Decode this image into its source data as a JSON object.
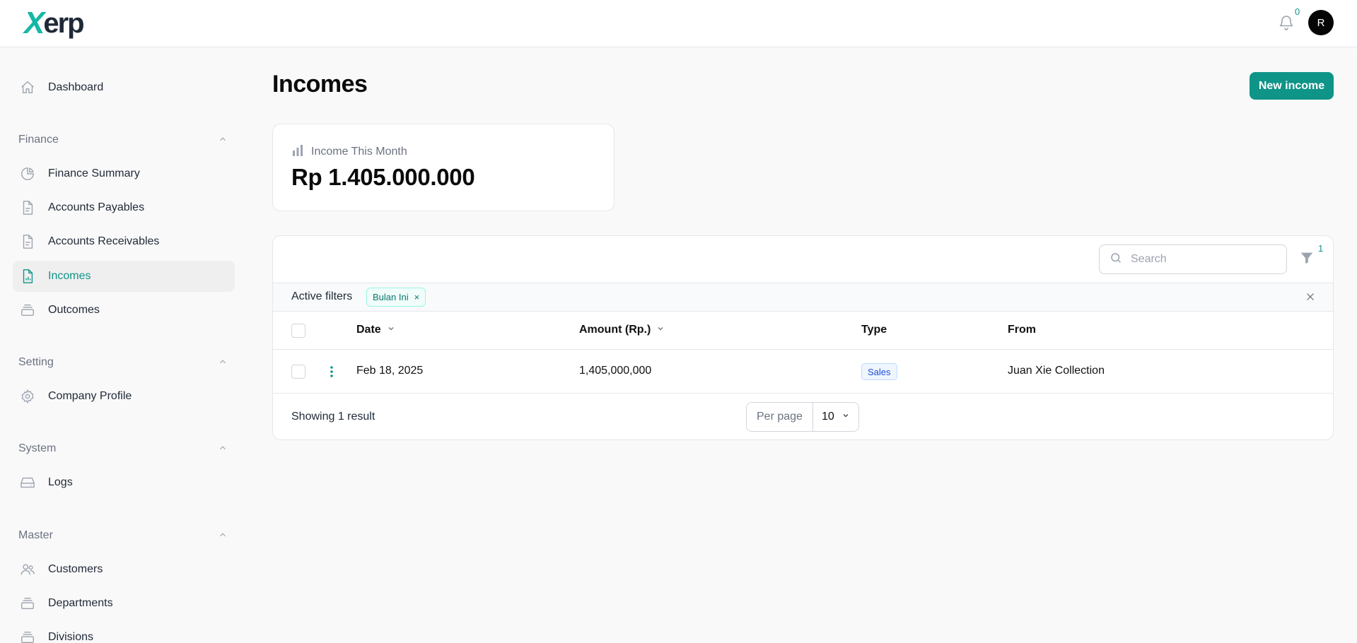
{
  "app": {
    "logo_text_x": "X",
    "logo_text_rest": "erp"
  },
  "header": {
    "notifications_count": "0",
    "avatar_initial": "R"
  },
  "sidebar": {
    "dashboard": "Dashboard",
    "groups": {
      "finance": "Finance",
      "setting": "Setting",
      "system": "System",
      "master": "Master"
    },
    "items": {
      "finance_summary": "Finance Summary",
      "accounts_payables": "Accounts Payables",
      "accounts_receivables": "Accounts Receivables",
      "incomes": "Incomes",
      "outcomes": "Outcomes",
      "company_profile": "Company Profile",
      "logs": "Logs",
      "customers": "Customers",
      "departments": "Departments",
      "divisions": "Divisions"
    },
    "active_item": "incomes"
  },
  "page": {
    "title": "Incomes",
    "new_button": "New income"
  },
  "stat": {
    "label": "Income This Month",
    "value": "Rp 1.405.000.000"
  },
  "table": {
    "search_placeholder": "Search",
    "filter_count": "1",
    "active_filters_label": "Active filters",
    "filter_chip": "Bulan Ini",
    "filter_chip_remove": "×",
    "columns": {
      "date": "Date",
      "amount": "Amount (Rp.)",
      "type": "Type",
      "from": "From"
    },
    "rows": [
      {
        "date": "Feb 18, 2025",
        "amount": "1,405,000,000",
        "type": "Sales",
        "from": "Juan Xie Collection"
      }
    ],
    "showing": "Showing 1 result",
    "per_page_label": "Per page",
    "per_page_value": "10"
  },
  "colors": {
    "accent": "#0f9488",
    "badge_blue": "#1d4ed8"
  }
}
